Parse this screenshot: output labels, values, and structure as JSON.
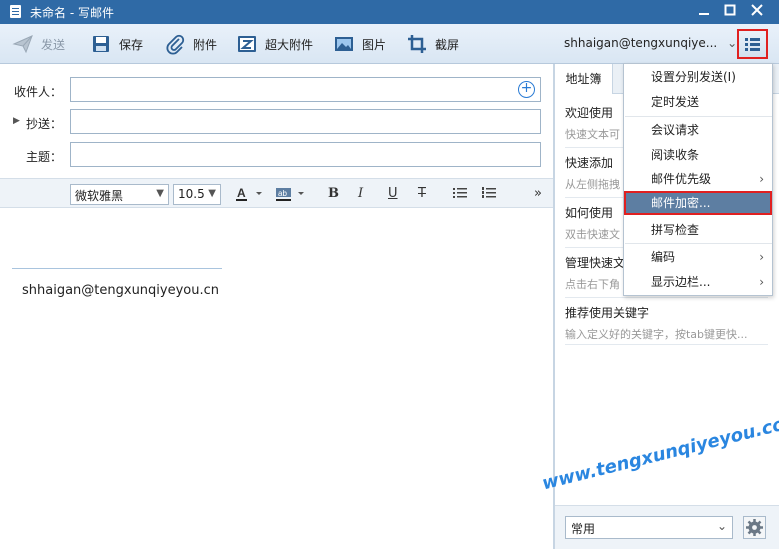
{
  "window": {
    "title": "未命名 - 写邮件"
  },
  "toolbar": {
    "send": "发送",
    "save": "保存",
    "attach": "附件",
    "big_attach": "超大附件",
    "picture": "图片",
    "screenshot": "截屏",
    "account": "shhaigan@tengxunqiye...",
    "account_caret": "⌄"
  },
  "compose": {
    "to_label": "收件人：",
    "cc_label": "抄送：",
    "subject_label": "主题：",
    "to_value": "",
    "cc_value": "",
    "subject_value": ""
  },
  "format": {
    "font": "微软雅黑",
    "size": "10.5",
    "more": "»"
  },
  "editor": {
    "signature": "shhaigan@tengxunqiyeyou.cn"
  },
  "sidebar": {
    "tab_address": "地址簿",
    "items": [
      {
        "title": "欢迎使用",
        "desc": "快速文本可"
      },
      {
        "title": "快速添加",
        "desc": "从左侧拖拽"
      },
      {
        "title": "如何使用",
        "desc": "双击快速文"
      },
      {
        "title": "管理快速文",
        "desc": "点击右下角"
      },
      {
        "title": "推荐使用关键字",
        "desc": "输入定义好的关键字，按tab键更快..."
      }
    ],
    "category": "常用"
  },
  "menu": {
    "items": [
      {
        "label": "设置分别发送(I)",
        "arrow": ""
      },
      {
        "label": "定时发送",
        "arrow": ""
      },
      {
        "label": "会议请求",
        "arrow": ""
      },
      {
        "label": "阅读收条",
        "arrow": ""
      },
      {
        "label": "邮件优先级",
        "arrow": "›"
      },
      {
        "label": "邮件加密...",
        "arrow": ""
      },
      {
        "label": "拼写检查",
        "arrow": ""
      },
      {
        "label": "编码",
        "arrow": "›"
      },
      {
        "label": "显示边栏...",
        "arrow": "›"
      }
    ]
  },
  "watermark": "www.tengxunqiyeyou.com",
  "colors": {
    "titlebar": "#2f6aa6",
    "highlight": "#5d7ea2",
    "annotation_red": "#e02020",
    "watermark": "#2a86e0"
  }
}
